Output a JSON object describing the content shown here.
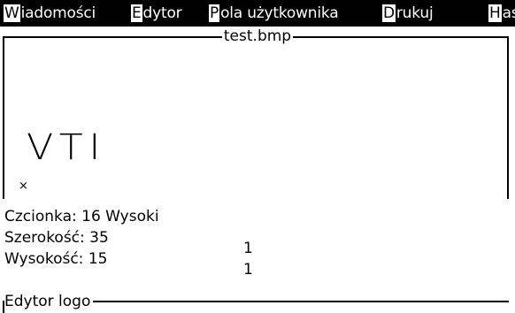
{
  "menu": {
    "items": [
      {
        "hotkey": "W",
        "rest": "iadomości"
      },
      {
        "hotkey": "E",
        "rest": "dytor"
      },
      {
        "hotkey": "P",
        "rest": "ola użytkownika"
      },
      {
        "hotkey": "D",
        "rest": "rukuj"
      },
      {
        "hotkey": "H",
        "rest": "as"
      }
    ]
  },
  "editor": {
    "filename": "test.bmp",
    "logo_text": "VTI",
    "cursor_glyph": "×"
  },
  "info": {
    "font_label": "Czcionka:",
    "font_value": "16 Wysoki",
    "width_label": "Szerokość:",
    "width_value": "35",
    "width_factor": "1",
    "height_label": "Wysokość:",
    "height_value": "15",
    "height_factor": "1"
  },
  "footer": {
    "title": "Edytor logo"
  }
}
